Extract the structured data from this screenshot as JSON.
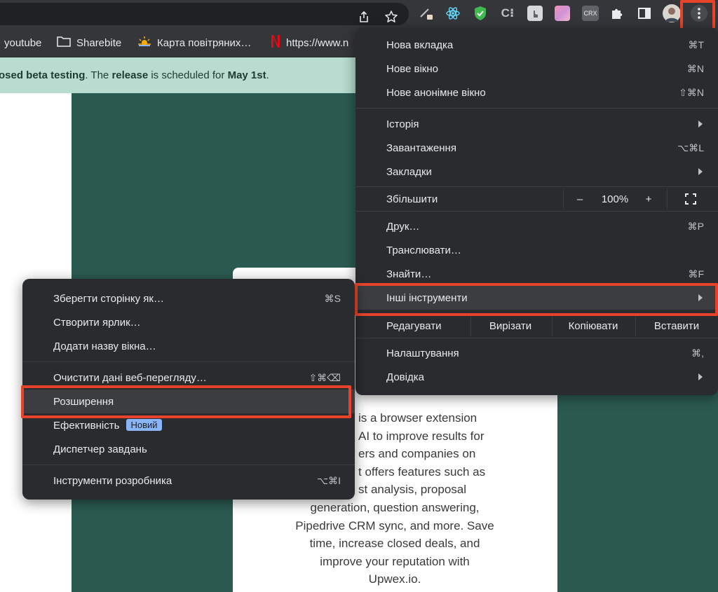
{
  "toolbar": {
    "icons": [
      "share-icon",
      "star-icon",
      "pen-extension-icon",
      "react-devtools-icon",
      "shield-extension-icon",
      "c-extension-icon",
      "touch-extension-icon",
      "gradient-extension-icon",
      "crx-extension-icon",
      "puzzle-icon",
      "sidepanel-icon",
      "avatar",
      "kebab-menu-icon"
    ],
    "crx_label": "CRX",
    "c_label": "C⁝"
  },
  "bookmarks": [
    {
      "icon": "folder-icon",
      "label": "youtube"
    },
    {
      "icon": "folder-icon",
      "label": "Sharebite"
    },
    {
      "icon": "sun-icon",
      "label": "Карта повітряних…"
    },
    {
      "icon": "netflix-icon",
      "label": "https://www.n"
    }
  ],
  "banner": {
    "part1": "osed beta testing",
    "part2": ". The ",
    "part3": "release",
    "part4": " is scheduled for ",
    "part5": "May 1st",
    "part6": "."
  },
  "page": {
    "description_lines": [
      "is a browser extension",
      "AI to improve results for",
      "ers and companies on",
      "t offers features such as",
      "st analysis, proposal",
      "generation, question answering,",
      "Pipedrive CRM sync, and more. Save",
      "time, increase closed deals, and",
      "improve your reputation with",
      "Upwex.io."
    ]
  },
  "main_menu": {
    "new_tab": {
      "label": "Нова вкладка",
      "shortcut": "⌘T"
    },
    "new_window": {
      "label": "Нове вікно",
      "shortcut": "⌘N"
    },
    "incognito": {
      "label": "Нове анонімне вікно",
      "shortcut": "⇧⌘N"
    },
    "history": {
      "label": "Історія"
    },
    "downloads": {
      "label": "Завантаження",
      "shortcut": "⌥⌘L"
    },
    "bookmarks": {
      "label": "Закладки"
    },
    "zoom": {
      "label": "Збільшити",
      "minus": "–",
      "value": "100%",
      "plus": "+"
    },
    "print": {
      "label": "Друк…",
      "shortcut": "⌘P"
    },
    "cast": {
      "label": "Транслювати…"
    },
    "find": {
      "label": "Знайти…",
      "shortcut": "⌘F"
    },
    "more_tools": {
      "label": "Інші інструменти"
    },
    "edit": {
      "label": "Редагувати",
      "cut": "Вирізати",
      "copy": "Копіювати",
      "paste": "Вставити"
    },
    "settings": {
      "label": "Налаштування",
      "shortcut": "⌘,"
    },
    "help": {
      "label": "Довідка"
    }
  },
  "sub_menu": {
    "save_page": {
      "label": "Зберегти сторінку як…",
      "shortcut": "⌘S"
    },
    "create_shortcut": {
      "label": "Створити ярлик…"
    },
    "name_window": {
      "label": "Додати назву вікна…"
    },
    "clear_data": {
      "label": "Очистити дані веб-перегляду…",
      "shortcut": "⇧⌘⌫"
    },
    "extensions": {
      "label": "Розширення"
    },
    "performance": {
      "label": "Ефективність",
      "badge": "Новий"
    },
    "task_manager": {
      "label": "Диспетчер завдань"
    },
    "dev_tools": {
      "label": "Інструменти розробника",
      "shortcut": "⌥⌘I"
    }
  },
  "colors": {
    "chrome_bg": "#35363a",
    "menu_bg": "#2a2b2e",
    "banner_bg": "#b8dccf",
    "hero_bg": "#2b5a51",
    "highlight": "#e8432a",
    "badge": "#8ab4f8"
  }
}
